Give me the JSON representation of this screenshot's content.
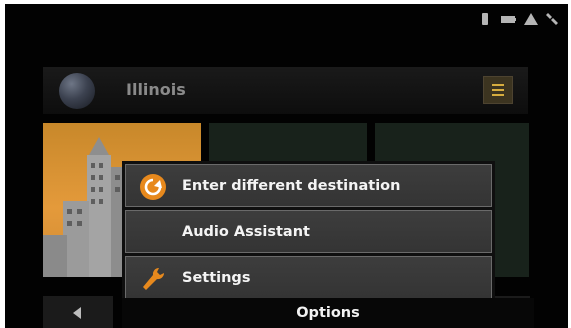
{
  "header": {
    "title": "Illinois"
  },
  "status_icons": [
    "phone-icon",
    "battery-icon",
    "gps-signal-icon",
    "satellite-icon"
  ],
  "menu": {
    "items": [
      {
        "label": "Enter different destination",
        "icon": "recalculate-icon"
      },
      {
        "label": "Audio Assistant",
        "icon": ""
      },
      {
        "label": "Settings",
        "icon": "wrench-icon"
      }
    ]
  },
  "options_bar": {
    "label": "Options"
  },
  "colors": {
    "accent": "#e7891d",
    "menu_bg": "#3a3a3a",
    "screen_bg": "#020202"
  }
}
